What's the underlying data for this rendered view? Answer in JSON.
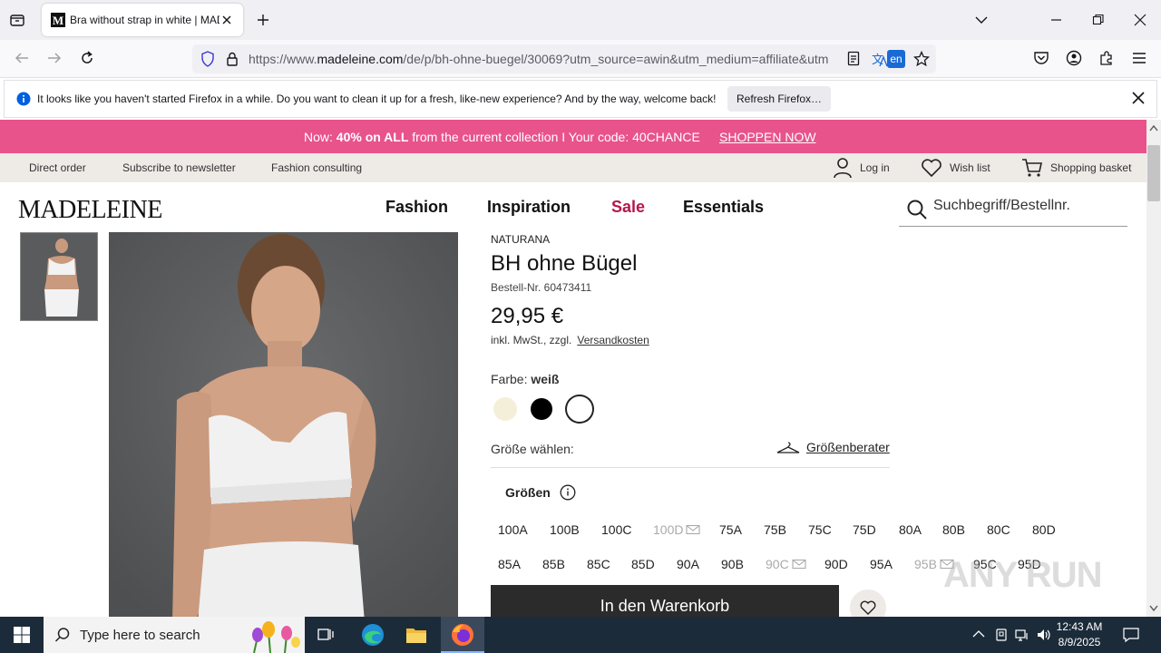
{
  "browser": {
    "tab_title": "Bra without strap in white | MADELEINE",
    "url_prefix": "https://www.",
    "url_domain": "madeleine.com",
    "url_path": "/de/p/bh-ohne-buegel/30069?utm_source=awin&utm_medium=affiliate&utm",
    "translate_lang": "en",
    "notification": {
      "message": "It looks like you haven't started Firefox in a while. Do you want to clean it up for a fresh, like-new experience? And by the way, welcome back!",
      "button": "Refresh Firefox…"
    }
  },
  "promo": {
    "prefix": "Now: ",
    "bold": "40% on ALL",
    "suffix": " from the current collection I Your code: 40CHANCE",
    "link": "SHOPPEN NOW"
  },
  "service_bar": {
    "direct_order": "Direct order",
    "newsletter": "Subscribe to newsletter",
    "consulting": "Fashion consulting",
    "login": "Log in",
    "wishlist": "Wish list",
    "basket": "Shopping basket"
  },
  "header": {
    "logo": "MADELEINE",
    "nav": [
      "Fashion",
      "Inspiration",
      "Sale",
      "Essentials"
    ],
    "search_placeholder": "Suchbegriff/Bestellnr."
  },
  "product": {
    "brand": "NATURANA",
    "title": "BH ohne Bügel",
    "article_number": "Bestell-Nr. 60473411",
    "price": "29,95 €",
    "tax_note": "inkl. MwSt., zzgl.",
    "shipping_link": "Versandkosten",
    "color_label": "Farbe: ",
    "color_value": "weiß",
    "swatches": [
      {
        "color": "#f3efd9"
      },
      {
        "color": "#000000"
      },
      {
        "color": "#ffffff",
        "selected": true
      }
    ],
    "size_select_label": "Größe wählen:",
    "size_advisor": "Größenberater",
    "sizes_heading": "Größen",
    "sizes_row1": [
      {
        "label": "100A",
        "available": true
      },
      {
        "label": "100B",
        "available": true
      },
      {
        "label": "100C",
        "available": true
      },
      {
        "label": "100D",
        "available": false
      },
      {
        "label": "75A",
        "available": true
      },
      {
        "label": "75B",
        "available": true
      },
      {
        "label": "75C",
        "available": true
      },
      {
        "label": "75D",
        "available": true
      },
      {
        "label": "80A",
        "available": true
      },
      {
        "label": "80B",
        "available": true
      },
      {
        "label": "80C",
        "available": true
      },
      {
        "label": "80D",
        "available": true
      }
    ],
    "sizes_row2": [
      {
        "label": "85A",
        "available": true
      },
      {
        "label": "85B",
        "available": true
      },
      {
        "label": "85C",
        "available": true
      },
      {
        "label": "85D",
        "available": true
      },
      {
        "label": "90A",
        "available": true
      },
      {
        "label": "90B",
        "available": true
      },
      {
        "label": "90C",
        "available": false
      },
      {
        "label": "90D",
        "available": true
      },
      {
        "label": "95A",
        "available": true
      },
      {
        "label": "95B",
        "available": false
      },
      {
        "label": "95C",
        "available": true
      },
      {
        "label": "95D",
        "available": true
      }
    ],
    "add_to_cart": "In den Warenkorb"
  },
  "watermark": "ANY RUN",
  "taskbar": {
    "search_placeholder": "Type here to search",
    "time": "12:43 AM",
    "date": "8/9/2025"
  },
  "colors": {
    "promo_bg": "#e8538c",
    "sale": "#b5174f",
    "service_bg": "#eeeae6",
    "cart_bg": "#2b2b2b"
  }
}
